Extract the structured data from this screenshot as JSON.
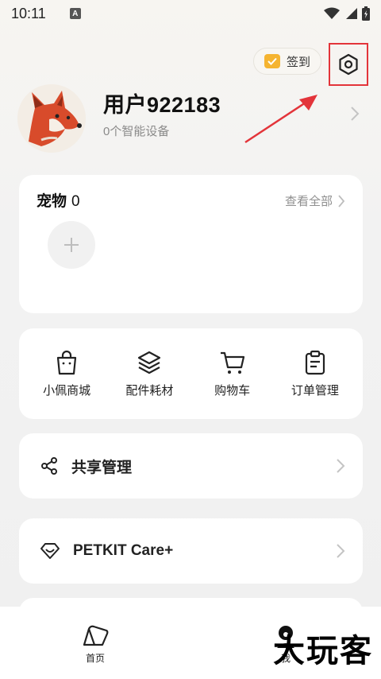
{
  "status_bar": {
    "time": "10:11",
    "notification_badge": "A"
  },
  "header": {
    "signin_label": "签到"
  },
  "profile": {
    "username": "用户922183",
    "devices": "0个智能设备"
  },
  "pets": {
    "title": "宠物",
    "count": "0",
    "view_all": "查看全部"
  },
  "shortcuts": [
    {
      "label": "小佩商城",
      "icon": "shopping-bag-icon"
    },
    {
      "label": "配件耗材",
      "icon": "layers-icon"
    },
    {
      "label": "购物车",
      "icon": "cart-icon"
    },
    {
      "label": "订单管理",
      "icon": "clipboard-icon"
    }
  ],
  "share": {
    "label": "共享管理",
    "icon": "share-icon"
  },
  "care": {
    "label": "PETKIT Care+",
    "icon": "heart-diamond-icon"
  },
  "tabs": [
    {
      "label": "首页",
      "icon": "home-icon"
    },
    {
      "label": "我",
      "icon": "person-icon"
    }
  ],
  "watermark": "大玩客",
  "colors": {
    "accent_red": "#e3343a",
    "calendar_yellow": "#f5b431"
  }
}
